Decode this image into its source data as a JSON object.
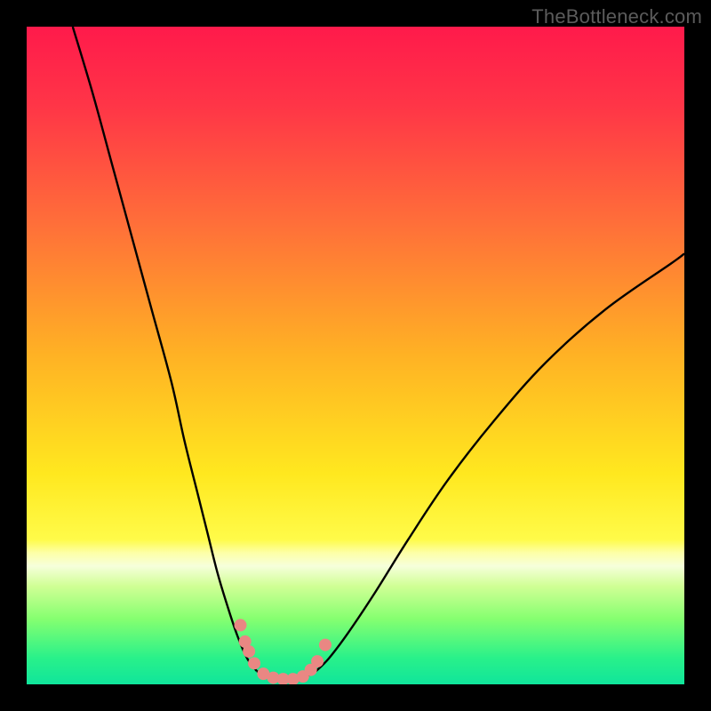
{
  "watermark": "TheBottleneck.com",
  "colors": {
    "frame": "#000000",
    "curve_stroke": "#000000",
    "marker_fill": "#e98783",
    "gradient_stops": [
      {
        "offset": 0.0,
        "color": "#ff1a4b"
      },
      {
        "offset": 0.12,
        "color": "#ff3547"
      },
      {
        "offset": 0.3,
        "color": "#ff6f39"
      },
      {
        "offset": 0.5,
        "color": "#ffb224"
      },
      {
        "offset": 0.68,
        "color": "#ffe81f"
      },
      {
        "offset": 0.78,
        "color": "#fffb49"
      },
      {
        "offset": 0.8,
        "color": "#fdffa7"
      },
      {
        "offset": 0.82,
        "color": "#f6ffdb"
      },
      {
        "offset": 0.85,
        "color": "#d1ff96"
      },
      {
        "offset": 0.9,
        "color": "#86ff70"
      },
      {
        "offset": 0.96,
        "color": "#29f18a"
      },
      {
        "offset": 1.0,
        "color": "#10e59b"
      }
    ]
  },
  "chart_data": {
    "type": "line",
    "title": "",
    "xlabel": "",
    "ylabel": "",
    "xlim": [
      0,
      100
    ],
    "ylim": [
      0,
      100
    ],
    "series": [
      {
        "name": "left-curve",
        "x": [
          7,
          10,
          13,
          16,
          19,
          22,
          24,
          26,
          27.5,
          29,
          30.5,
          32,
          33.5,
          35
        ],
        "y": [
          100,
          90,
          79,
          68,
          57,
          46,
          37,
          29,
          23,
          17,
          12,
          7.5,
          4,
          2
        ]
      },
      {
        "name": "right-curve",
        "x": [
          44,
          46,
          49,
          53,
          58,
          64,
          71,
          79,
          88,
          98,
          100
        ],
        "y": [
          2,
          4,
          8,
          14,
          22,
          31,
          40,
          49,
          57,
          64,
          65.5
        ]
      },
      {
        "name": "floor",
        "x": [
          35,
          37,
          40,
          42,
          44
        ],
        "y": [
          2,
          1,
          0.7,
          1,
          2
        ]
      }
    ],
    "markers": {
      "name": "data-points",
      "points": [
        {
          "x": 32.5,
          "y": 9
        },
        {
          "x": 33.2,
          "y": 6.5
        },
        {
          "x": 33.8,
          "y": 5
        },
        {
          "x": 34.6,
          "y": 3.2
        },
        {
          "x": 36.0,
          "y": 1.6
        },
        {
          "x": 37.5,
          "y": 1.0
        },
        {
          "x": 39.0,
          "y": 0.8
        },
        {
          "x": 40.5,
          "y": 0.8
        },
        {
          "x": 42.0,
          "y": 1.2
        },
        {
          "x": 43.2,
          "y": 2.2
        },
        {
          "x": 44.2,
          "y": 3.5
        },
        {
          "x": 45.4,
          "y": 6.0
        }
      ],
      "radius": 7
    }
  }
}
